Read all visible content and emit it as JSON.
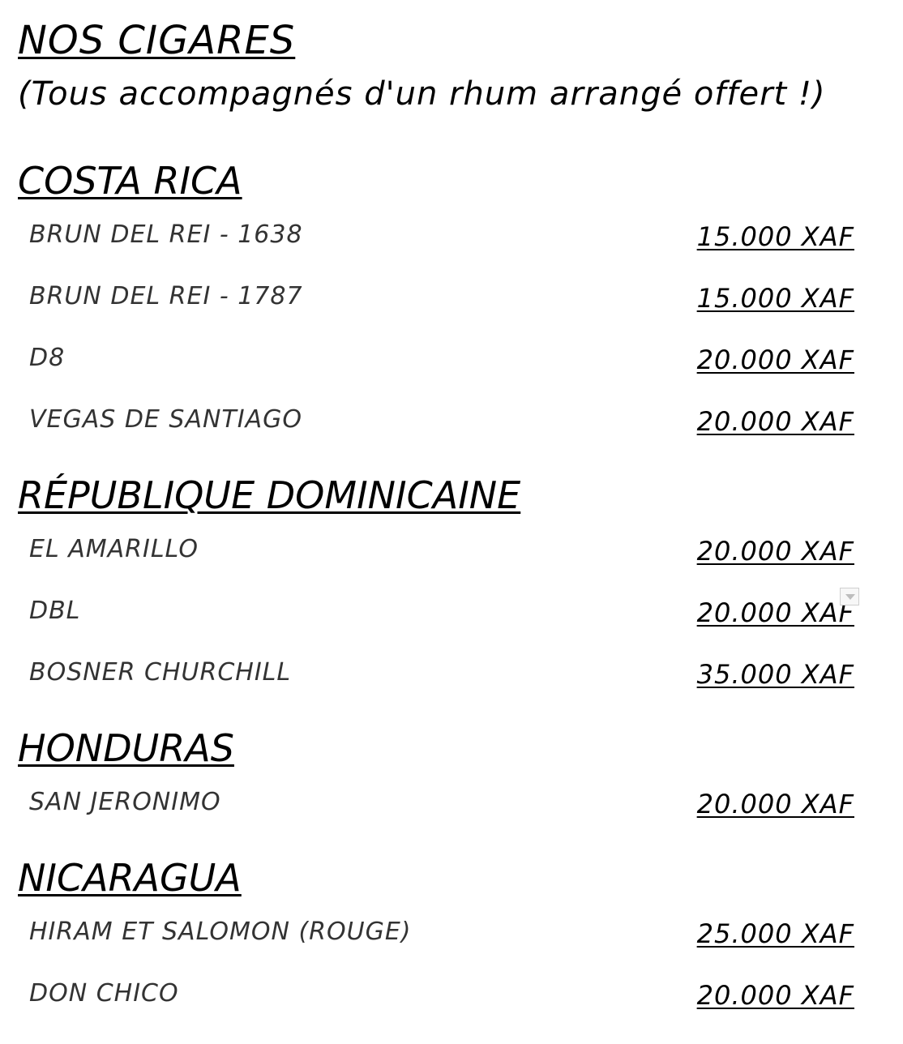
{
  "menu": {
    "title": "NOS CIGARES",
    "subtitle": "(Tous accompagnés d'un rhum arrangé offert !)",
    "sections": [
      {
        "heading": "COSTA RICA",
        "items": [
          {
            "name": "BRUN DEL REI - 1638",
            "price": "15.000 XAF"
          },
          {
            "name": "BRUN DEL REI - 1787",
            "price": "15.000 XAF"
          },
          {
            "name": "D8",
            "price": "20.000 XAF"
          },
          {
            "name": "VEGAS DE SANTIAGO",
            "price": "20.000 XAF"
          }
        ]
      },
      {
        "heading": "RÉPUBLIQUE DOMINICAINE",
        "items": [
          {
            "name": "EL AMARILLO",
            "price": "20.000 XAF"
          },
          {
            "name": "DBL",
            "price": "20.000 XAF"
          },
          {
            "name": "BOSNER CHURCHILL",
            "price": "35.000 XAF"
          }
        ]
      },
      {
        "heading": "HONDURAS",
        "items": [
          {
            "name": "SAN JERONIMO",
            "price": "20.000 XAF"
          }
        ]
      },
      {
        "heading": "NICARAGUA",
        "items": [
          {
            "name": "HIRAM ET SALOMON (ROUGE)",
            "price": "25.000 XAF"
          },
          {
            "name": "DON CHICO",
            "price": "20.000 XAF"
          }
        ]
      }
    ]
  },
  "icons": {
    "dropdown": "chevron-down-icon"
  }
}
